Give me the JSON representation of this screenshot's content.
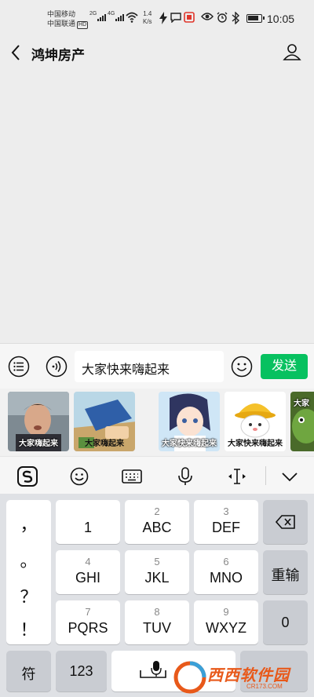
{
  "status_bar": {
    "carrier_1": "中国移动",
    "carrier_2": "中国联通",
    "hd_badge": "HD",
    "signal_1_tag": "2G",
    "signal_2_tag": "4G",
    "net_speed_value": "1.4",
    "net_speed_unit": "K/s",
    "time": "10:05",
    "battery_level": 0.85
  },
  "header": {
    "title": "鸿坤房产",
    "back_icon": "chevron-left-icon",
    "profile_icon": "person-icon"
  },
  "input_bar": {
    "menu_icon": "list-icon",
    "voice_icon": "voice-icon",
    "message_text": "大家快来嗨起来",
    "emoji_icon": "smiley-icon",
    "send_label": "发送",
    "send_color": "#07c160"
  },
  "stickers": [
    {
      "caption": "大家嗨起来"
    },
    {
      "caption": "大家嗨起来"
    },
    {
      "caption": "大家快来嗨起来"
    },
    {
      "caption": "大家快来嗨起来"
    },
    {
      "caption": "大家"
    }
  ],
  "keyboard_toolbar": {
    "items": [
      "sogou-logo-icon",
      "emoji-icon",
      "keyboard-icon",
      "microphone-icon",
      "cursor-icon",
      "chevron-down-icon"
    ]
  },
  "keyboard": {
    "punctuation": [
      "，",
      "。",
      "？",
      "！"
    ],
    "keys": [
      {
        "num": "",
        "letters": "1"
      },
      {
        "num": "2",
        "letters": "ABC"
      },
      {
        "num": "3",
        "letters": "DEF"
      },
      {
        "num": "4",
        "letters": "GHI"
      },
      {
        "num": "5",
        "letters": "JKL"
      },
      {
        "num": "6",
        "letters": "MNO"
      },
      {
        "num": "7",
        "letters": "PQRS"
      },
      {
        "num": "8",
        "letters": "TUV"
      },
      {
        "num": "9",
        "letters": "WXYZ"
      }
    ],
    "backspace_icon": "backspace-icon",
    "reenter_label": "重输",
    "zero_label": "0",
    "symbol_label": "符",
    "numeric_label": "123",
    "space_icon": "space-icon"
  },
  "watermark": {
    "text": "西西软件园",
    "sub": "CR173.COM"
  }
}
